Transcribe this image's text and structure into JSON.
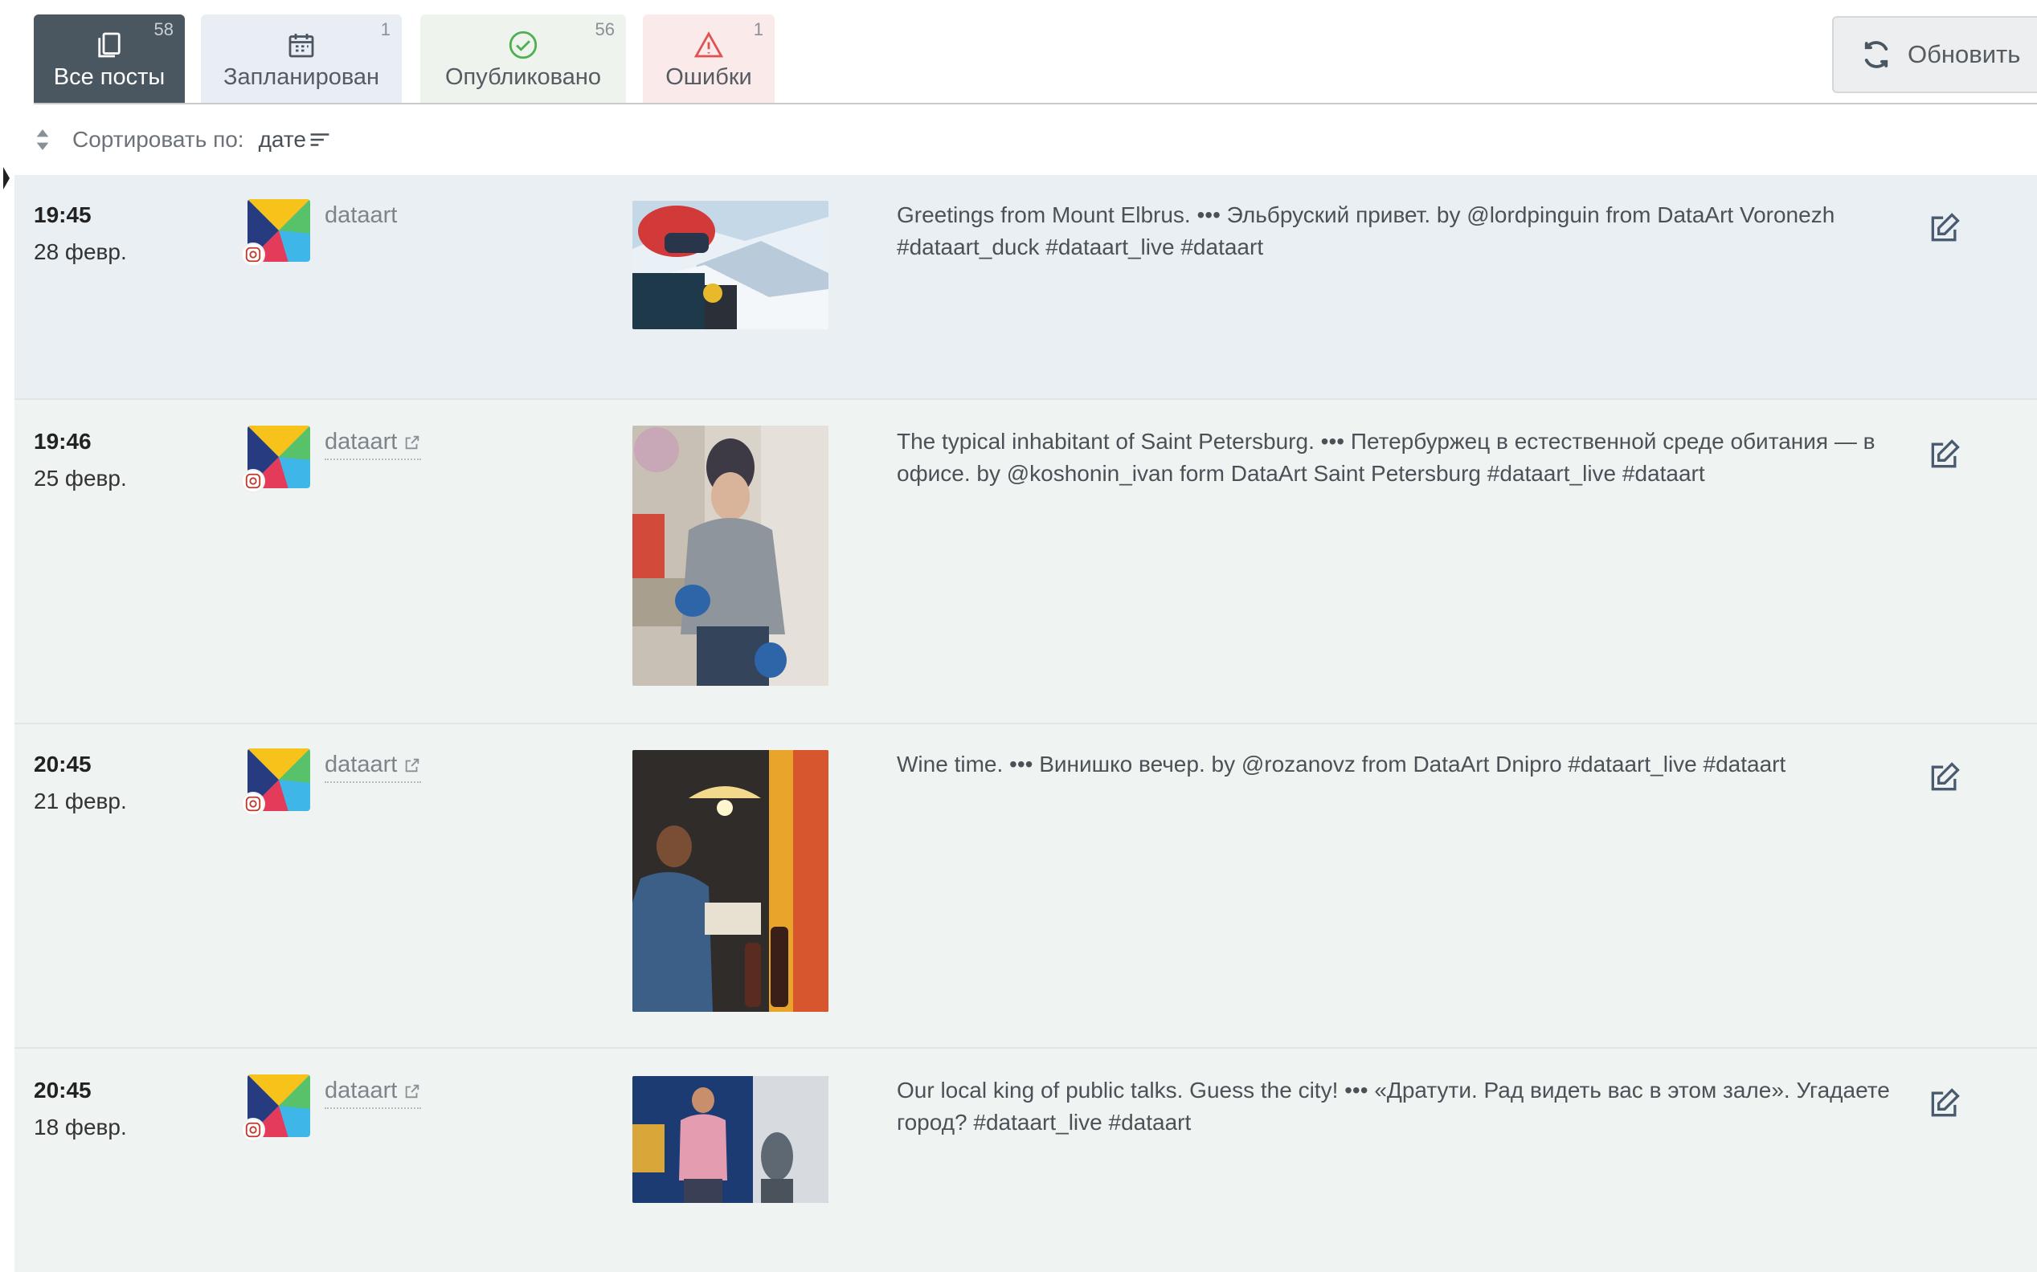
{
  "tabs": [
    {
      "label": "Все посты",
      "count": "58",
      "icon": "copy-icon",
      "active": true
    },
    {
      "label": "Запланирован",
      "count": "1",
      "icon": "calendar-icon"
    },
    {
      "label": "Опубликовано",
      "count": "56",
      "icon": "check-circle-icon"
    },
    {
      "label": "Ошибки",
      "count": "1",
      "icon": "warning-icon"
    }
  ],
  "refresh": {
    "label": "Обновить",
    "icon": "refresh-icon"
  },
  "sort": {
    "label": "Сортировать по:",
    "value": "дате"
  },
  "colors": {
    "active_tab": "#4a5660",
    "scheduled_tab": "#e9eef4",
    "published_tab": "#eef3ee",
    "errors_tab": "#fbeaea",
    "error_red": "#e05252",
    "success_green": "#4caf50",
    "post_bg": "#eff3f1",
    "first_post_bg": "#eaeff4"
  },
  "posts": [
    {
      "time": "19:45",
      "date": "28 февр.",
      "account": "dataart",
      "account_link": false,
      "text": "Greetings from Mount Elbrus. ••• Эльбруский привет. by @lordpinguin from DataArt Voronezh #dataart_duck #dataart_live #dataart"
    },
    {
      "time": "19:46",
      "date": "25 февр.",
      "account": "dataart",
      "account_link": true,
      "text": "The typical inhabitant of Saint Petersburg. ••• Петербуржец в естественной среде обитания — в офисе. by @koshonin_ivan form DataArt Saint Petersburg #dataart_live #dataart"
    },
    {
      "time": "20:45",
      "date": "21 февр.",
      "account": "dataart",
      "account_link": true,
      "text": "Wine time. ••• Винишко вечер. by @rozanovz from DataArt Dnipro #dataart_live #dataart"
    },
    {
      "time": "20:45",
      "date": "18 февр.",
      "account": "dataart",
      "account_link": true,
      "text": "Our local king of public talks. Guess the city! ••• «Дратути. Рад видеть вас в этом зале». Угадаете город? #dataart_live #dataart"
    }
  ]
}
